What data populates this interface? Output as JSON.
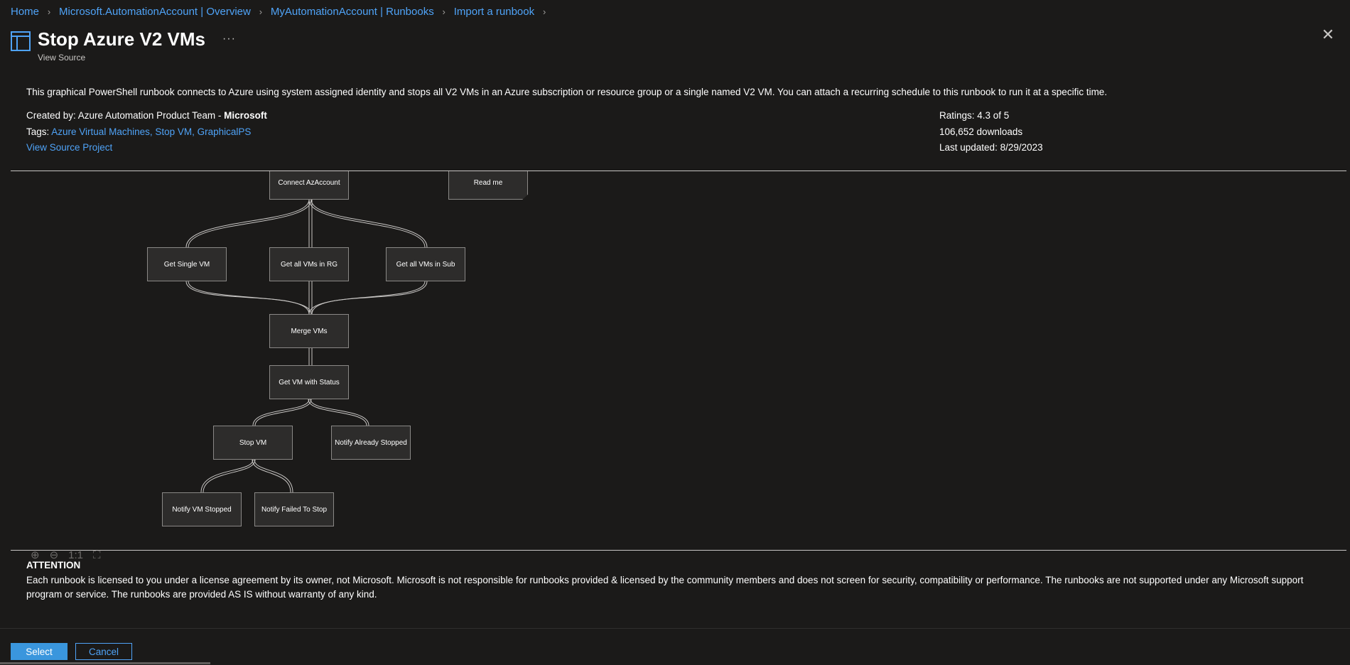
{
  "breadcrumb": [
    {
      "label": "Home"
    },
    {
      "label": "Microsoft.AutomationAccount | Overview"
    },
    {
      "label": "MyAutomationAccount | Runbooks"
    },
    {
      "label": "Import a runbook"
    }
  ],
  "header": {
    "title": "Stop Azure V2 VMs",
    "subtitle": "View Source",
    "more": "···",
    "close": "✕"
  },
  "description": "This graphical PowerShell runbook connects to Azure using system assigned identity and stops all V2 VMs in an Azure subscription or resource group or a single named V2 VM. You can attach a recurring schedule to this runbook to run it at a specific time.",
  "meta": {
    "created_by_label": "Created by: Azure Automation Product Team - ",
    "created_by_org": "Microsoft",
    "tags_label": "Tags: ",
    "tags": "Azure Virtual Machines, Stop VM, GraphicalPS",
    "view_source": "View Source Project",
    "ratings": "Ratings: 4.3 of 5",
    "downloads": "106,652 downloads",
    "last_updated": "Last updated: 8/29/2023"
  },
  "diagram": {
    "nodes": [
      {
        "label": "Connect AzAccount"
      },
      {
        "label": "Read me"
      },
      {
        "label": "Get Single VM"
      },
      {
        "label": "Get all VMs in RG"
      },
      {
        "label": "Get all VMs in Sub"
      },
      {
        "label": "Merge VMs"
      },
      {
        "label": "Get VM with Status"
      },
      {
        "label": "Stop VM"
      },
      {
        "label": "Notify Already Stopped"
      },
      {
        "label": "Notify VM Stopped"
      },
      {
        "label": "Notify Failed To Stop"
      }
    ],
    "zoom_in": "⊕",
    "zoom_out": "⊖",
    "actual_size": "1:1",
    "fit": "⛶"
  },
  "attention": {
    "title": "ATTENTION",
    "text": "Each runbook is licensed to you under a license agreement by its owner, not Microsoft. Microsoft is not responsible for runbooks provided & licensed by the community members and does not screen for security, compatibility or performance. The runbooks are not supported under any Microsoft support program or service. The runbooks are provided AS IS without warranty of any kind."
  },
  "buttons": {
    "select": "Select",
    "cancel": "Cancel"
  }
}
